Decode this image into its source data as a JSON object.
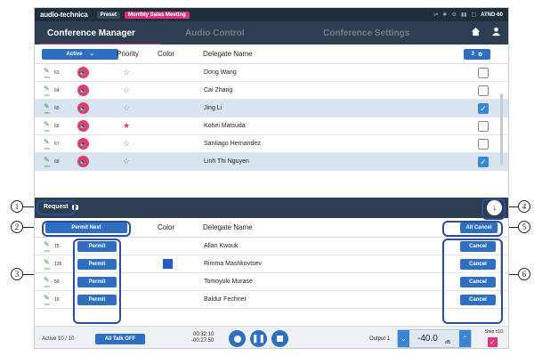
{
  "topbar": {
    "logo": "audio-technica",
    "preset_label": "Preset",
    "meeting": "Monthly Sales Meeting",
    "model": "ATND-60",
    "icons": [
      "usb-icon",
      "network-icon",
      "settings-icon",
      "signal-icon",
      "lock-icon"
    ]
  },
  "tabs": [
    {
      "label": "Conference Manager",
      "active": true
    },
    {
      "label": "Audio Control",
      "active": false
    },
    {
      "label": "Conference Settings",
      "active": false
    }
  ],
  "delegates": {
    "filter_label": "Active",
    "headers": {
      "priority": "Priority",
      "color": "Color",
      "name": "Delegate Name"
    },
    "count_badge": "2",
    "rows": [
      {
        "num": "63",
        "name": "Dong Wang",
        "priority": false,
        "checked": false,
        "selected": false
      },
      {
        "num": "64",
        "name": "Cai Zhang",
        "priority": false,
        "checked": false,
        "selected": false
      },
      {
        "num": "65",
        "name": "Jing Li",
        "priority": false,
        "checked": true,
        "selected": true
      },
      {
        "num": "66",
        "name": "Kohei Matsuda",
        "priority": true,
        "checked": false,
        "selected": false
      },
      {
        "num": "67",
        "name": "Santiago Hernandez",
        "priority": false,
        "checked": false,
        "selected": false
      },
      {
        "num": "68",
        "name": "Linh Thi Nguyen",
        "priority": false,
        "checked": true,
        "selected": true
      }
    ]
  },
  "request": {
    "label": "Request",
    "count": "5",
    "permit_next": "Permit Next",
    "all_cancel": "All Cancel",
    "headers": {
      "color": "Color",
      "name": "Delegate Name"
    },
    "rows": [
      {
        "num": "15",
        "name": "Allan Kwouk",
        "permit": "Permit",
        "cancel": "Cancel",
        "swatch": false
      },
      {
        "num": "126",
        "name": "Rimma Mashkovtsev",
        "permit": "Permit",
        "cancel": "Cancel",
        "swatch": true
      },
      {
        "num": "50",
        "name": "Tomoyuki Murase",
        "permit": "Permit",
        "cancel": "Cancel",
        "swatch": false
      },
      {
        "num": "10",
        "name": "Baldur Fechner",
        "permit": "Permit",
        "cancel": "Cancel",
        "swatch": false
      }
    ]
  },
  "bottom": {
    "active": "Active  10 / 10",
    "all_talk_off": "All Talk OFF",
    "time_elapsed": "00:32:10",
    "time_remaining": "-00:27:50",
    "output_label": "Output 1",
    "volume": "-40.0",
    "volume_unit": "dB",
    "step_label": "Step ±10"
  },
  "callouts": [
    "1",
    "2",
    "3",
    "4",
    "5",
    "6"
  ],
  "colors": {
    "accent": "#2f6fc2",
    "pink": "#e0357a",
    "dark": "#2c3e50",
    "swatch": "#2a5bc7"
  }
}
